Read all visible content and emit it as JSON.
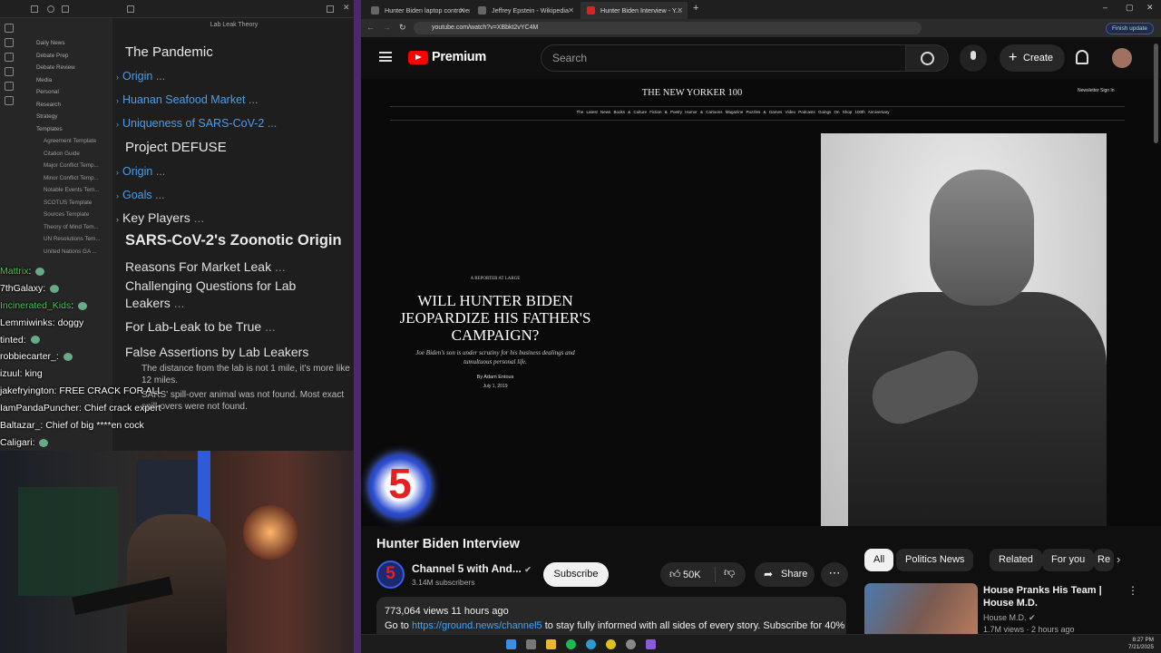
{
  "obsidian": {
    "note_title": "Lab Leak Theory",
    "folders": [
      "Daily News",
      "Debate Prep",
      "Debate Review",
      "Media",
      "Personal",
      "Research",
      "Strategy",
      "Templates"
    ],
    "templates": [
      "Agreement Template",
      "Citation Guide",
      "Major Conflict Temp...",
      "Minor Conflict Temp...",
      "Notable Events Tem...",
      "SCOTUS Template",
      "Sources Template",
      "Theory of Mind Tem...",
      "UN Resolutions Tem...",
      "United Nations GA ..."
    ],
    "note": {
      "h1": "The Pandemic",
      "links1": [
        "Origin",
        "Huanan Seafood Market",
        "Uniqueness of SARS-CoV-2"
      ],
      "h2": "Project DEFUSE",
      "links2": [
        "Origin",
        "Goals"
      ],
      "key_players": "Key Players",
      "bold": "SARS-CoV-2's Zoonotic Origin",
      "sections": [
        "Reasons For Market Leak",
        "Challenging Questions for Lab Leakers",
        "For Lab-Leak to be True",
        "False Assertions by Lab Leakers"
      ],
      "ellipsis": "...",
      "tail1": "The distance from the lab is not 1 mile, it's more like 12 miles.",
      "tail2": "SARS' spill-over animal was not found. Most exact spill-overs were not found."
    }
  },
  "chat": [
    {
      "user": "Mattrix",
      "msg": "",
      "green": true
    },
    {
      "user": "7thGalaxy",
      "msg": "",
      "green": false
    },
    {
      "user": "Incinerated_Kids",
      "msg": "",
      "green": true
    },
    {
      "user": "Lemmiwinks",
      "msg": "doggy",
      "green": false
    },
    {
      "user": "tinted",
      "msg": "",
      "green": false
    },
    {
      "user": "robbiecarter_",
      "msg": "",
      "green": false
    },
    {
      "user": "izuul",
      "msg": "king",
      "green": false
    },
    {
      "user": "jakefryington",
      "msg": "FREE CRACK FOR ALL",
      "green": false
    },
    {
      "user": "IamPandaPuncher",
      "msg": "Chief crack expert",
      "green": false
    },
    {
      "user": "Baltazar_",
      "msg": "Chief of big ****en cock",
      "green": false
    },
    {
      "user": "Caligari",
      "msg": "",
      "green": false
    }
  ],
  "browser": {
    "tabs": [
      "Hunter Biden laptop controvers...",
      "Jeffrey Epstein - Wikipedia",
      "Hunter Biden Interview - Y..."
    ],
    "url": "youtube.com/watch?v=XBbkt2vYC4M",
    "finish_update": "Finish update"
  },
  "youtube": {
    "brand": "Premium",
    "search_placeholder": "Search",
    "create": "Create",
    "video_title": "Hunter Biden Interview",
    "channel": "Channel 5 with And...",
    "subscribers": "3.14M subscribers",
    "subscribe": "Subscribe",
    "likes": "50K",
    "share": "Share",
    "views": "773,064 views  11 hours ago",
    "desc_pre": "Go to ",
    "desc_link": "https://ground.news/channel5",
    "desc_post": " to stay fully informed with all sides of every story. Subscribe for 40%",
    "chips": [
      "All",
      "Politics News",
      "Related",
      "For you",
      "Re"
    ],
    "rec_title": "House Pranks His Team | House M.D.",
    "rec_channel": "House M.D.",
    "rec_meta": "1.7M views · 2 hours ago"
  },
  "newyorker": {
    "logo": "THE NEW YORKER 100",
    "right": "Newsletter   Sign In",
    "nav": "The Latest  News  Books & Culture  Fiction & Poetry  Humor & Cartoons  Magazine  Puzzles & Games  Video  Podcasts  Goings On  Shop  100th Anniversary",
    "kicker": "A REPORTER AT LARGE",
    "headline": "WILL HUNTER BIDEN JEOPARDIZE HIS FATHER'S CAMPAIGN?",
    "dek": "Joe Biden's son is under scrutiny for his business dealings and tumultuous personal life.",
    "byline": "By Adam Entous",
    "date": "July 1, 2019",
    "channel_badge": "5"
  },
  "taskbar": {
    "time": "8:27 PM",
    "date": "7/21/2025"
  }
}
